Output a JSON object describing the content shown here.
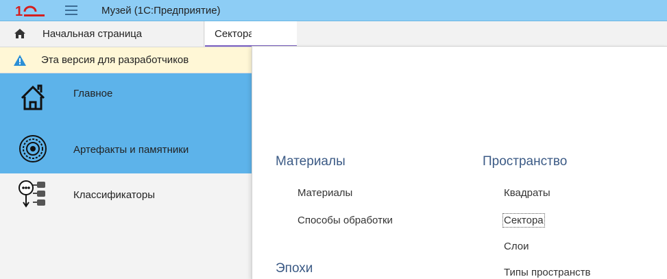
{
  "window": {
    "title": "Музей  (1С:Предприятие)"
  },
  "tabs": {
    "home": "Начальная страница",
    "sectors": "Сектора"
  },
  "notice": {
    "text": "Эта версия для разработчиков"
  },
  "sidebar": {
    "items": [
      {
        "label": "Главное"
      },
      {
        "label": "Артефакты и памятники"
      },
      {
        "label": "Классификаторы"
      }
    ]
  },
  "panel": {
    "materials": {
      "title": "Материалы",
      "items": [
        "Материалы",
        "Способы обработки"
      ]
    },
    "epochs": {
      "title": "Эпохи"
    },
    "space": {
      "title": "Пространство",
      "items": [
        "Квадраты",
        "Сектора",
        "Слои",
        "Типы пространств"
      ]
    }
  },
  "colors": {
    "titlebar": "#8dcdf5",
    "sidebar_active": "#5db3ea",
    "accent": "#7a5fc0",
    "group_title": "#3b5a85"
  }
}
